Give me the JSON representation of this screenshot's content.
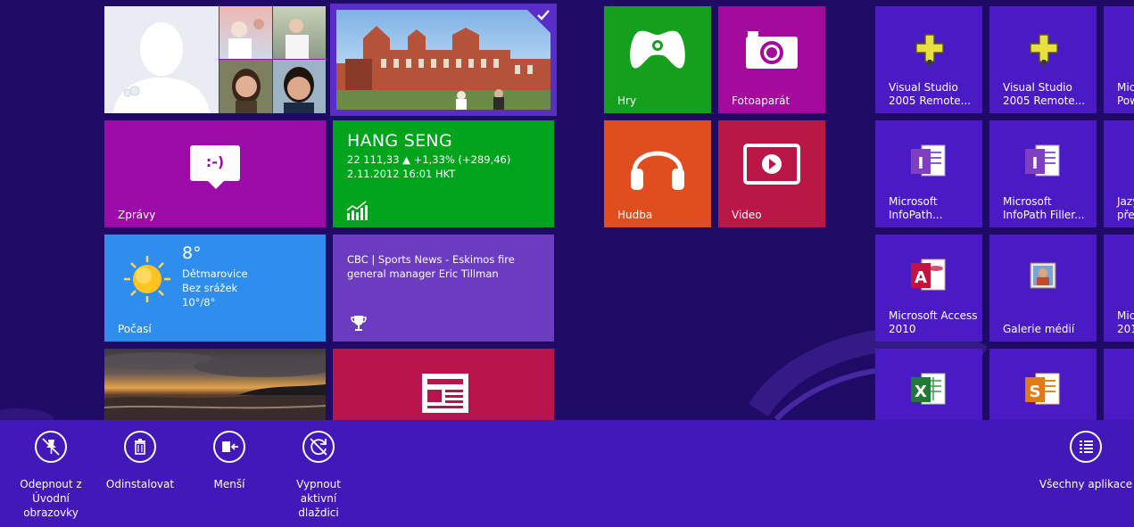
{
  "tiles": {
    "messaging_label": "Zprávy",
    "messaging_glyph": ":-)",
    "finance": {
      "title": "HANG SENG",
      "value_line": "22 111,33  ▲ +1,33% (+289,46)",
      "date_line": "2.11.2012 16:01 HKT"
    },
    "weather": {
      "temp": "8°",
      "city": "Dětmarovice",
      "condition": "Bez srážek",
      "range": "10°/8°",
      "label": "Počasí"
    },
    "sports": {
      "headline_line1": "CBC | Sports News - Eskimos fire",
      "headline_line2": "general manager Eric Tillman"
    },
    "games_label": "Hry",
    "camera_label": "Fotoaparát",
    "music_label": "Hudba",
    "video_label": "Video",
    "vs1_line1": "Visual Studio",
    "vs1_line2": "2005 Remote...",
    "vs2_line1": "Visual Studio",
    "vs2_line2": "2005 Remote...",
    "col3_row1_line1": "Mic",
    "col3_row1_line2": "Pow",
    "infopath1_line1": "Microsoft",
    "infopath1_line2": "InfoPath...",
    "infopath2_line1": "Microsoft",
    "infopath2_line2": "InfoPath Filler...",
    "col3_row2_line1": "Jazy",
    "col3_row2_line2": "před",
    "access_line1": "Microsoft Access",
    "access_line2": "2010",
    "gallery_label": "Galerie médií",
    "col3_row3_line1": "Mic",
    "col3_row3_line2": "201"
  },
  "appbar": {
    "unpin_label": "Odepnout z Úvodní obrazovky",
    "uninstall_label": "Odinstalovat",
    "smaller_label": "Menší",
    "live_off_label": "Vypnout aktivní dlaždici",
    "all_apps_label": "Všechny aplikace"
  },
  "colors": {
    "background": "#1f0a66",
    "appbar": "#4218b8",
    "app_tile": "#4a1ac4",
    "messaging": "#9c0aa8",
    "finance": "#00a31c",
    "weather": "#2e8ded",
    "sports": "#6b3bc0",
    "news": "#b8134a",
    "games": "#14a01c",
    "camera": "#a2099c",
    "music": "#e04e1f",
    "video": "#b91847"
  }
}
